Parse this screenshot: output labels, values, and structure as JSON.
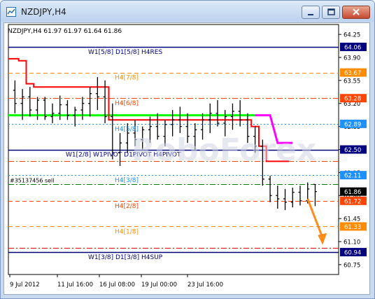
{
  "window": {
    "title": "NZDJPY,H4",
    "buttons": [
      "minimize",
      "maximize",
      "close"
    ]
  },
  "chart_header": "NZDJPY,H4  61.97 61.97 61.64 61.86",
  "watermark": "RoboForex",
  "order_label": "#35137456 sell",
  "colors": {
    "background": "#ffffff",
    "axis": "#000000",
    "candles": "#000000",
    "navy_level": "#00007f",
    "orange_level": "#ff8c00",
    "red_level": "#ff4500",
    "blue_level": "#1e90ff",
    "green_order": "#008000",
    "red_ma": "#ff0000",
    "green_ma": "#00ff00",
    "magenta_ma": "#ff00ff",
    "arrow": "#ff8c1a"
  },
  "chart_data": {
    "type": "line",
    "symbol": "NZDJPY",
    "timeframe": "H4",
    "ohlc_header": {
      "open": 61.97,
      "high": 61.97,
      "low": 61.64,
      "close": 61.86
    },
    "y_axis_ticks": [
      64.25,
      63.9,
      63.55,
      63.2,
      62.85,
      62.5,
      62.15,
      61.8,
      61.45,
      61.1,
      60.75
    ],
    "x_axis_ticks": [
      "9 Jul 2012",
      "11 Jul 16:00",
      "16 Jul 08:00",
      "19 Jul 00:00",
      "23 Jul 16:00"
    ],
    "levels": [
      {
        "label": "W1[5/8] D1[5/8] H4RES",
        "price": 64.06,
        "style": "solid",
        "color": "#00007f"
      },
      {
        "label": "H4[7/8]",
        "price": 63.67,
        "style": "dashed",
        "color": "#ff8c00"
      },
      {
        "label": "H4[6/8]",
        "price": 63.28,
        "style": "dash-dot",
        "color": "#ff4500"
      },
      {
        "label": "H4[5/8]",
        "price": 62.89,
        "style": "dotted",
        "color": "#1e90ff"
      },
      {
        "label": "W1[2/8] W1PIVOT D1PIVOT H4PIVOT",
        "price": 62.5,
        "style": "solid",
        "color": "#00007f"
      },
      {
        "label": "",
        "price": 62.32,
        "style": "dash-dot",
        "color": "#ff4500"
      },
      {
        "label": "H4[3/8]",
        "price": 62.11,
        "style": "dotted",
        "color": "#1e90ff"
      },
      {
        "label": "#35137456 sell",
        "price": 61.97,
        "style": "dash-dot",
        "color": "#008000"
      },
      {
        "label": "H4[2/8]",
        "price": 61.72,
        "style": "dashed",
        "color": "#ff4500"
      },
      {
        "label": "H4[1/8]",
        "price": 61.33,
        "style": "dashed",
        "color": "#ff8c00"
      },
      {
        "label": "",
        "price": 61.0,
        "style": "dash-dot",
        "color": "#ff0000"
      },
      {
        "label": "W1[3/8] D1[3/8] H4SUP",
        "price": 60.94,
        "style": "solid",
        "color": "#00007f"
      }
    ],
    "price_tags": [
      {
        "price": 64.06,
        "text": "64.06",
        "bg": "#00007f",
        "fg": "#ffffff"
      },
      {
        "price": 63.67,
        "text": "63.67",
        "bg": "#ff8c00",
        "fg": "#ffffff"
      },
      {
        "price": 63.28,
        "text": "63.28",
        "bg": "#ff4500",
        "fg": "#ffffff"
      },
      {
        "price": 62.89,
        "text": "62.89",
        "bg": "#1e90ff",
        "fg": "#ffffff"
      },
      {
        "price": 62.5,
        "text": "62.50",
        "bg": "#00007f",
        "fg": "#ffffff"
      },
      {
        "price": 62.11,
        "text": "62.11",
        "bg": "#1e90ff",
        "fg": "#ffffff"
      },
      {
        "price": 61.86,
        "text": "61.86",
        "bg": "#000000",
        "fg": "#ffffff"
      },
      {
        "price": 61.72,
        "text": "61.72",
        "bg": "#ff4500",
        "fg": "#ffffff"
      },
      {
        "price": 61.33,
        "text": "61.33",
        "bg": "#ff8c00",
        "fg": "#ffffff"
      },
      {
        "price": 60.94,
        "text": "60.94",
        "bg": "#00007f",
        "fg": "#ffffff"
      }
    ],
    "candles": [
      {
        "o": 63.4,
        "h": 63.55,
        "l": 63.05,
        "c": 63.2
      },
      {
        "o": 63.2,
        "h": 63.42,
        "l": 62.95,
        "c": 63.3
      },
      {
        "o": 63.3,
        "h": 63.45,
        "l": 63.0,
        "c": 63.1
      },
      {
        "o": 63.1,
        "h": 63.3,
        "l": 62.95,
        "c": 63.25
      },
      {
        "o": 63.25,
        "h": 63.3,
        "l": 62.95,
        "c": 63.0
      },
      {
        "o": 63.0,
        "h": 63.2,
        "l": 62.9,
        "c": 63.05
      },
      {
        "o": 63.05,
        "h": 63.32,
        "l": 62.95,
        "c": 63.18
      },
      {
        "o": 63.18,
        "h": 63.25,
        "l": 62.95,
        "c": 63.02
      },
      {
        "o": 63.02,
        "h": 63.15,
        "l": 62.85,
        "c": 63.1
      },
      {
        "o": 63.1,
        "h": 63.3,
        "l": 62.95,
        "c": 63.2
      },
      {
        "o": 63.2,
        "h": 63.45,
        "l": 63.0,
        "c": 63.35
      },
      {
        "o": 63.35,
        "h": 63.6,
        "l": 63.1,
        "c": 63.3
      },
      {
        "o": 63.3,
        "h": 63.55,
        "l": 62.9,
        "c": 63.0
      },
      {
        "o": 63.0,
        "h": 63.2,
        "l": 62.35,
        "c": 62.45
      },
      {
        "o": 62.45,
        "h": 62.75,
        "l": 62.25,
        "c": 62.6
      },
      {
        "o": 62.6,
        "h": 62.9,
        "l": 62.45,
        "c": 62.75
      },
      {
        "o": 62.75,
        "h": 62.95,
        "l": 62.55,
        "c": 62.65
      },
      {
        "o": 62.65,
        "h": 62.85,
        "l": 62.5,
        "c": 62.8
      },
      {
        "o": 62.8,
        "h": 63.0,
        "l": 62.6,
        "c": 62.85
      },
      {
        "o": 62.85,
        "h": 63.05,
        "l": 62.65,
        "c": 62.7
      },
      {
        "o": 62.7,
        "h": 62.95,
        "l": 62.55,
        "c": 62.88
      },
      {
        "o": 62.88,
        "h": 63.1,
        "l": 62.7,
        "c": 62.95
      },
      {
        "o": 62.95,
        "h": 63.15,
        "l": 62.75,
        "c": 62.85
      },
      {
        "o": 62.85,
        "h": 63.05,
        "l": 62.6,
        "c": 62.7
      },
      {
        "o": 62.7,
        "h": 62.9,
        "l": 62.5,
        "c": 62.8
      },
      {
        "o": 62.8,
        "h": 63.05,
        "l": 62.65,
        "c": 62.95
      },
      {
        "o": 62.95,
        "h": 63.2,
        "l": 62.75,
        "c": 63.05
      },
      {
        "o": 63.05,
        "h": 63.25,
        "l": 62.85,
        "c": 62.9
      },
      {
        "o": 62.9,
        "h": 63.1,
        "l": 62.7,
        "c": 63.0
      },
      {
        "o": 63.0,
        "h": 63.2,
        "l": 62.8,
        "c": 63.08
      },
      {
        "o": 63.08,
        "h": 63.25,
        "l": 62.85,
        "c": 62.95
      },
      {
        "o": 62.95,
        "h": 63.05,
        "l": 62.6,
        "c": 62.7
      },
      {
        "o": 62.7,
        "h": 62.85,
        "l": 62.45,
        "c": 62.55
      },
      {
        "o": 62.55,
        "h": 62.65,
        "l": 61.95,
        "c": 62.05
      },
      {
        "o": 62.05,
        "h": 62.1,
        "l": 61.7,
        "c": 61.8
      },
      {
        "o": 61.8,
        "h": 61.95,
        "l": 61.6,
        "c": 61.75
      },
      {
        "o": 61.75,
        "h": 61.9,
        "l": 61.58,
        "c": 61.7
      },
      {
        "o": 61.7,
        "h": 61.92,
        "l": 61.62,
        "c": 61.85
      },
      {
        "o": 61.85,
        "h": 61.95,
        "l": 61.65,
        "c": 61.72
      },
      {
        "o": 61.72,
        "h": 62.0,
        "l": 61.68,
        "c": 61.9
      },
      {
        "o": 61.97,
        "h": 61.97,
        "l": 61.64,
        "c": 61.86
      }
    ],
    "red_ma": [
      63.88,
      63.85,
      63.5,
      63.45,
      63.45,
      63.45,
      63.45,
      63.45,
      63.45,
      63.45,
      63.45,
      63.45,
      63.45,
      62.95,
      62.95,
      62.95,
      62.95,
      62.95,
      62.95,
      62.95,
      62.95,
      62.95,
      62.95,
      62.95,
      62.95,
      62.95,
      62.95,
      62.95,
      62.95,
      62.95,
      62.95,
      62.95,
      62.85,
      62.55,
      62.32,
      62.32,
      62.32
    ],
    "green_ma": {
      "price": 63.02,
      "from_bar": 0,
      "to_bar": 32
    },
    "magenta_ma": [
      {
        "bar": 32,
        "price": 63.02
      },
      {
        "bar": 34,
        "price": 63.02
      },
      {
        "bar": 35,
        "price": 62.6
      },
      {
        "bar": 37,
        "price": 62.6
      }
    ],
    "forecast_arrow": {
      "from_bar": 39,
      "from_price": 61.75,
      "to_bar": 41,
      "to_price": 61.05
    },
    "ylim": [
      60.6,
      64.4
    ]
  }
}
